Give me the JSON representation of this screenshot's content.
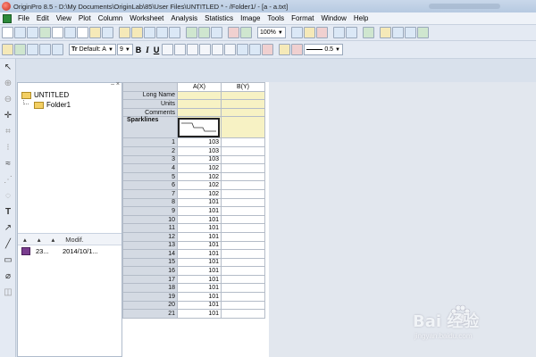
{
  "window": {
    "title": "OriginPro 8.5 - D:\\My Documents\\OriginLab\\85\\User Files\\UNTITLED * - /Folder1/ - [a - a.txt]"
  },
  "menu": [
    "File",
    "Edit",
    "View",
    "Plot",
    "Column",
    "Worksheet",
    "Analysis",
    "Statistics",
    "Image",
    "Tools",
    "Format",
    "Window",
    "Help"
  ],
  "toolbar1": {
    "zoom": "100%"
  },
  "toolbar2": {
    "font_prefix": "Tr",
    "font_name": "Default: A",
    "font_size": "9",
    "bold": "B",
    "italic": "I",
    "underline": "U",
    "line_width": "0.5"
  },
  "project_explorer": {
    "root": "UNTITLED",
    "folder": "Folder1",
    "list_headers": [
      "Modif."
    ],
    "items": [
      {
        "name": "23...",
        "modified": "2014/10/1..."
      }
    ]
  },
  "worksheet": {
    "columns": [
      "A(X)",
      "B(Y)"
    ],
    "meta_rows": [
      "Long Name",
      "Units",
      "Comments",
      "Sparklines"
    ],
    "rows": [
      {
        "n": "1",
        "a": "103"
      },
      {
        "n": "2",
        "a": "103"
      },
      {
        "n": "3",
        "a": "103"
      },
      {
        "n": "4",
        "a": "102"
      },
      {
        "n": "5",
        "a": "102"
      },
      {
        "n": "6",
        "a": "102"
      },
      {
        "n": "7",
        "a": "102"
      },
      {
        "n": "8",
        "a": "101"
      },
      {
        "n": "9",
        "a": "101"
      },
      {
        "n": "10",
        "a": "101"
      },
      {
        "n": "11",
        "a": "101"
      },
      {
        "n": "12",
        "a": "101"
      },
      {
        "n": "13",
        "a": "101"
      },
      {
        "n": "14",
        "a": "101"
      },
      {
        "n": "15",
        "a": "101"
      },
      {
        "n": "16",
        "a": "101"
      },
      {
        "n": "17",
        "a": "101"
      },
      {
        "n": "18",
        "a": "101"
      },
      {
        "n": "19",
        "a": "101"
      },
      {
        "n": "20",
        "a": "101"
      },
      {
        "n": "21",
        "a": "101"
      }
    ]
  },
  "watermark": {
    "main": "Bai 经验",
    "sub": "jingyan.baidu.com"
  }
}
